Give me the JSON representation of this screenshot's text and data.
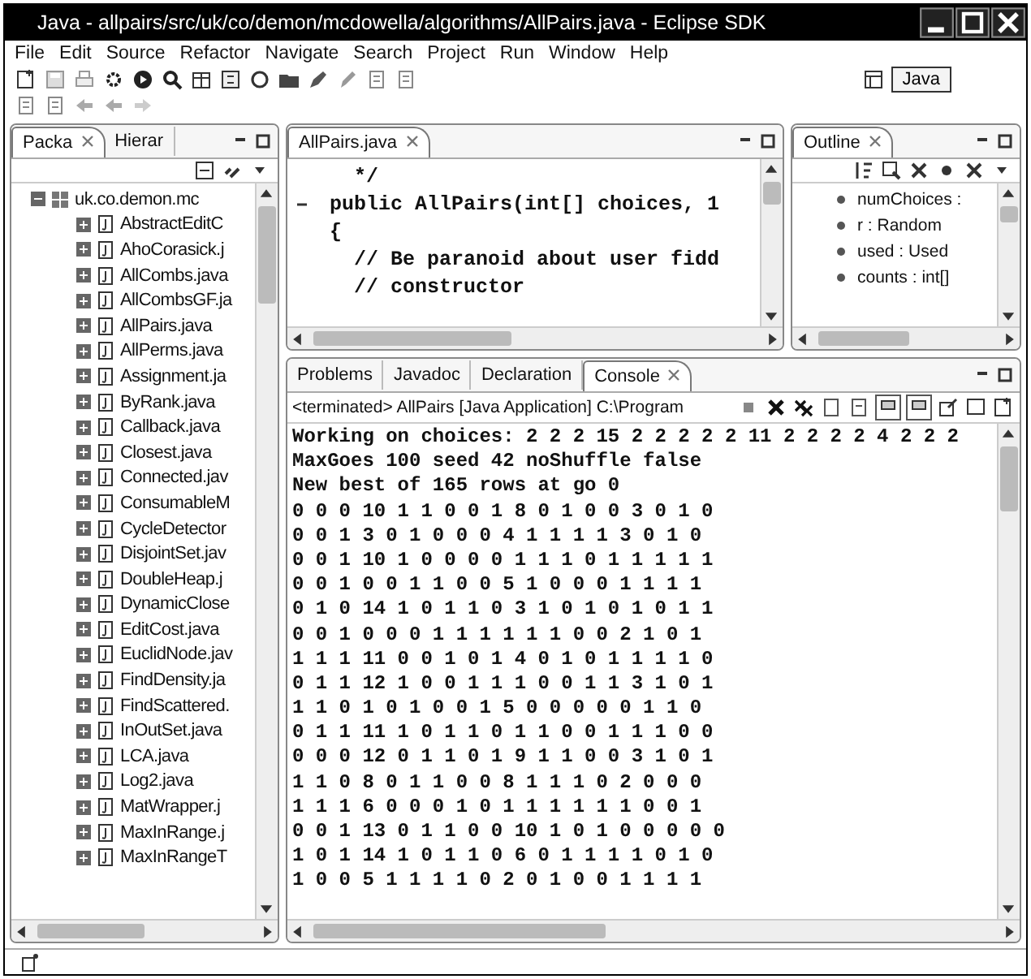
{
  "window": {
    "title": "Java - allpairs/src/uk/co/demon/mcdowella/algorithms/AllPairs.java - Eclipse SDK"
  },
  "menu": [
    "File",
    "Edit",
    "Source",
    "Refactor",
    "Navigate",
    "Search",
    "Project",
    "Run",
    "Window",
    "Help"
  ],
  "perspective": {
    "label": "Java",
    "selected": true
  },
  "package_explorer": {
    "tabs": [
      {
        "label": "Packa",
        "selected": true
      },
      {
        "label": "Hierar",
        "selected": false
      }
    ],
    "tree": {
      "label": "uk.co.demon.mc",
      "expanded": true,
      "children": [
        {
          "label": "AbstractEditC",
          "expanded": false
        },
        {
          "label": "AhoCorasick.j",
          "expanded": false
        },
        {
          "label": "AllCombs.java",
          "expanded": false
        },
        {
          "label": "AllCombsGF.ja",
          "expanded": false
        },
        {
          "label": "AllPairs.java",
          "expanded": false
        },
        {
          "label": "AllPerms.java",
          "expanded": false
        },
        {
          "label": "Assignment.ja",
          "expanded": false
        },
        {
          "label": "ByRank.java",
          "expanded": false
        },
        {
          "label": "Callback.java",
          "expanded": false
        },
        {
          "label": "Closest.java",
          "expanded": false
        },
        {
          "label": "Connected.jav",
          "expanded": false
        },
        {
          "label": "ConsumableM",
          "expanded": false
        },
        {
          "label": "CycleDetector",
          "expanded": false
        },
        {
          "label": "DisjointSet.jav",
          "expanded": false
        },
        {
          "label": "DoubleHeap.j",
          "expanded": false
        },
        {
          "label": "DynamicClose",
          "expanded": false
        },
        {
          "label": "EditCost.java",
          "expanded": false
        },
        {
          "label": "EuclidNode.jav",
          "expanded": false
        },
        {
          "label": "FindDensity.ja",
          "expanded": false
        },
        {
          "label": "FindScattered.",
          "expanded": false
        },
        {
          "label": "InOutSet.java",
          "expanded": false
        },
        {
          "label": "LCA.java",
          "expanded": false
        },
        {
          "label": "Log2.java",
          "expanded": false
        },
        {
          "label": "MatWrapper.j",
          "expanded": false
        },
        {
          "label": "MaxInRange.j",
          "expanded": false
        },
        {
          "label": "MaxInRangeT",
          "expanded": false
        }
      ]
    }
  },
  "editor": {
    "tabs": [
      {
        "label": "AllPairs.java",
        "selected": true
      }
    ],
    "lines": [
      {
        "text": "  */",
        "fold": false
      },
      {
        "text": "public AllPairs(int[] choices, 1",
        "fold": true
      },
      {
        "text": "{",
        "fold": false
      },
      {
        "text": "  // Be paranoid about user fidd",
        "fold": false
      },
      {
        "text": "  // constructor",
        "fold": false
      }
    ]
  },
  "outline": {
    "tabs": [
      {
        "label": "Outline",
        "selected": true
      }
    ],
    "items": [
      "numChoices :",
      "r : Random",
      "used : Used",
      "counts : int[]"
    ]
  },
  "console": {
    "tabs": [
      {
        "label": "Problems",
        "selected": false
      },
      {
        "label": "Javadoc",
        "selected": false
      },
      {
        "label": "Declaration",
        "selected": false
      },
      {
        "label": "Console",
        "selected": true
      }
    ],
    "header": "<terminated> AllPairs [Java Application] C:\\Program",
    "lines": [
      "Working on choices: 2 2 2 15 2 2 2 2 2 11 2 2 2 2 4 2 2 2",
      "MaxGoes 100 seed 42 noShuffle false",
      "New best of 165 rows at go 0",
      "0 0 0 10 1 1 0 0 1 8 0 1 0 0 3 0 1 0",
      "0 0 1 3 0 1 0 0 0 4 1 1 1 1 3 0 1 0",
      "0 0 1 10 1 0 0 0 0 1 1 1 0 1 1 1 1 1",
      "0 0 1 0 0 1 1 0 0 5 1 0 0 0 1 1 1 1",
      "0 1 0 14 1 0 1 1 0 3 1 0 1 0 1 0 1 1",
      "0 0 1 0 0 0 1 1 1 1 1 1 0 0 2 1 0 1",
      "1 1 1 11 0 0 1 0 1 4 0 1 0 1 1 1 1 0",
      "0 1 1 12 1 0 0 1 1 1 0 0 1 1 3 1 0 1",
      "1 1 0 1 0 1 0 0 1 5 0 0 0 0 0 1 1 0",
      "0 1 1 11 1 0 1 1 0 1 1 0 0 1 1 1 0 0",
      "0 0 0 12 0 1 1 0 1 9 1 1 0 0 3 1 0 1",
      "1 1 0 8 0 1 1 0 0 8 1 1 1 0 2 0 0 0",
      "1 1 1 6 0 0 0 1 0 1 1 1 1 1 1 0 0 1",
      "0 0 1 13 0 1 1 0 0 10 1 0 1 0 0 0 0 0",
      "1 0 1 14 1 0 1 1 0 6 0 1 1 1 1 0 1 0",
      "1 0 0 5 1 1 1 1 0 2 0 1 0 0 1 1 1 1"
    ]
  }
}
